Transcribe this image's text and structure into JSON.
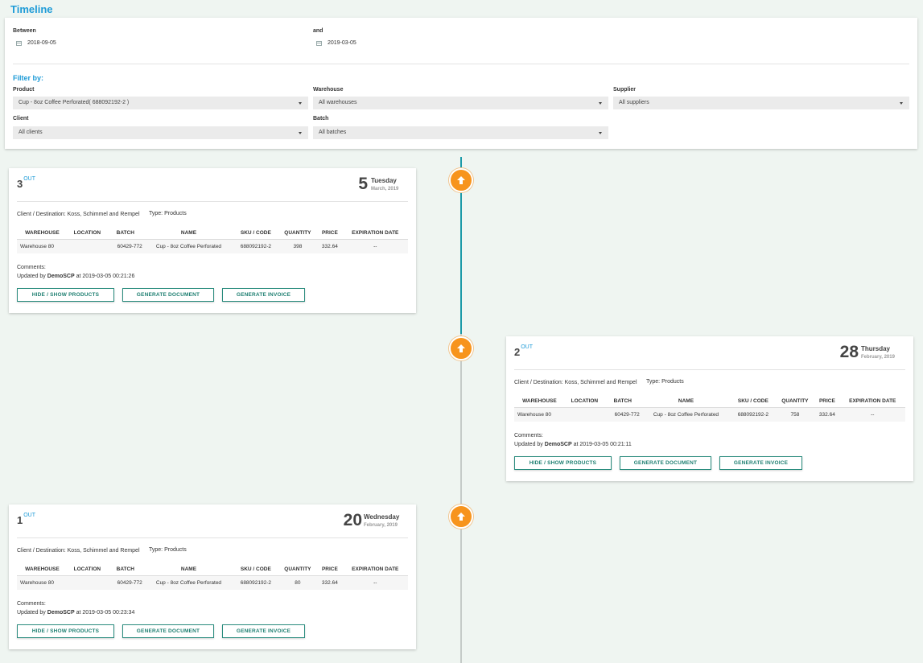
{
  "page": {
    "title": "Timeline"
  },
  "filters": {
    "between_label": "Between",
    "between_value": "2018-09-05",
    "and_label": "and",
    "and_value": "2019-03-05",
    "filter_by_label": "Filter by:",
    "product": {
      "label": "Product",
      "value": "Cup - 8oz Coffee Perforated( 688092192-2 )"
    },
    "warehouse": {
      "label": "Warehouse",
      "value": "All warehouses"
    },
    "supplier": {
      "label": "Supplier",
      "value": "All suppliers"
    },
    "client": {
      "label": "Client",
      "value": "All clients"
    },
    "batch": {
      "label": "Batch",
      "value": "All batches"
    }
  },
  "colors": {
    "accent": "#1e9bd7",
    "dot": "#f7941d",
    "button": "#1e7f71",
    "timeline_active": "#1c9aa8"
  },
  "icons": {
    "timeline_dot": "arrow-up-icon",
    "date_field": "calendar-icon",
    "select": "caret-down-icon"
  },
  "table_headers": [
    "WAREHOUSE",
    "LOCATION",
    "BATCH",
    "NAME",
    "SKU / CODE",
    "QUANTITY",
    "PRICE",
    "EXPIRATION DATE"
  ],
  "buttons": {
    "hide_show": "HIDE / SHOW PRODUCTS",
    "generate_document": "GENERATE DOCUMENT",
    "generate_invoice": "GENERATE INVOICE"
  },
  "cards": [
    {
      "number": "3",
      "direction": "OUT",
      "day": "5",
      "weekday": "Tuesday",
      "month_year": "March, 2019",
      "destination": "Client / Destination: Koss, Schimmel and Rempel",
      "type": "Type: Products",
      "row": {
        "warehouse": "Warehouse 80",
        "location": "",
        "batch": "60429-772",
        "name": "Cup - 8oz Coffee Perforated",
        "sku": "688092192-2",
        "quantity": "398",
        "price": "332.64",
        "expiration": "--"
      },
      "comments": "Comments:",
      "updated_prefix": "Updated by",
      "updated_user": "DemoSCP",
      "updated_at": "at 2019-03-05 00:21:26"
    },
    {
      "number": "2",
      "direction": "OUT",
      "day": "28",
      "weekday": "Thursday",
      "month_year": "February, 2019",
      "destination": "Client / Destination: Koss, Schimmel and Rempel",
      "type": "Type: Products",
      "row": {
        "warehouse": "Warehouse 80",
        "location": "",
        "batch": "60429-772",
        "name": "Cup - 8oz Coffee Perforated",
        "sku": "688092192-2",
        "quantity": "758",
        "price": "332.64",
        "expiration": "--"
      },
      "comments": "Comments:",
      "updated_prefix": "Updated by",
      "updated_user": "DemoSCP",
      "updated_at": "at 2019-03-05 00:21:11"
    },
    {
      "number": "1",
      "direction": "OUT",
      "day": "20",
      "weekday": "Wednesday",
      "month_year": "February, 2019",
      "destination": "Client / Destination: Koss, Schimmel and Rempel",
      "type": "Type: Products",
      "row": {
        "warehouse": "Warehouse 80",
        "location": "",
        "batch": "60429-772",
        "name": "Cup - 8oz Coffee Perforated",
        "sku": "688092192-2",
        "quantity": "80",
        "price": "332.64",
        "expiration": "--"
      },
      "comments": "Comments:",
      "updated_prefix": "Updated by",
      "updated_user": "DemoSCP",
      "updated_at": "at 2019-03-05 00:23:34"
    }
  ]
}
